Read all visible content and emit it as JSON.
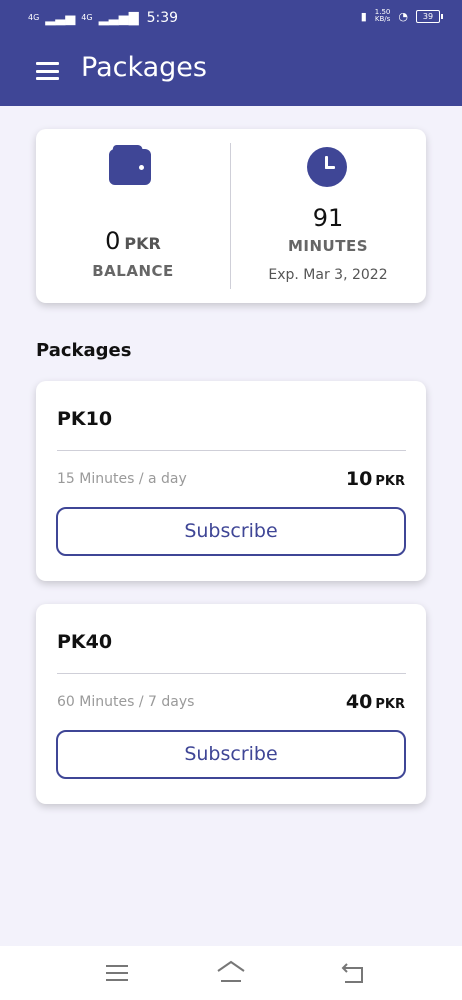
{
  "status_bar": {
    "signal_1": "4G",
    "signal_2": "4G",
    "time": "5:39",
    "speed": "1.50\nKB/s",
    "battery": "39"
  },
  "header": {
    "title": "Packages",
    "menu_icon": "hamburger-menu-icon"
  },
  "summary": {
    "balance_value": "0",
    "balance_unit": "PKR",
    "balance_label": "BALANCE",
    "minutes_value": "91",
    "minutes_label": "MINUTES",
    "expiry": "Exp. Mar 3, 2022",
    "wallet_icon": "wallet-icon",
    "clock_icon": "clock-icon"
  },
  "section_title": "Packages",
  "packages": [
    {
      "name": "PK10",
      "description": "15 Minutes / a day",
      "price": "10",
      "unit": "PKR",
      "button": "Subscribe"
    },
    {
      "name": "PK40",
      "description": "60 Minutes / 7 days",
      "price": "40",
      "unit": "PKR",
      "button": "Subscribe"
    }
  ],
  "nav": {
    "menu_icon": "recent-apps-icon",
    "home_icon": "home-icon",
    "back_icon": "back-icon"
  },
  "colors": {
    "primary": "#3f4696",
    "background": "#f3f2fb"
  }
}
